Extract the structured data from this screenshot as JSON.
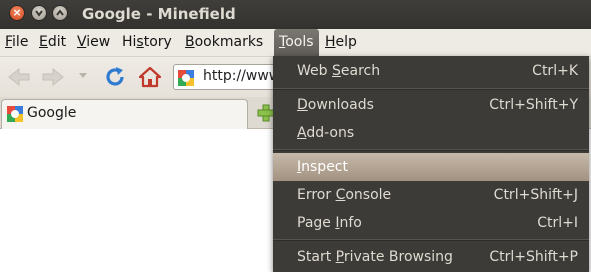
{
  "window": {
    "title": "Google - Minefield"
  },
  "menubar": {
    "items": [
      {
        "pre": "",
        "key": "F",
        "post": "ile"
      },
      {
        "pre": "",
        "key": "E",
        "post": "dit"
      },
      {
        "pre": "",
        "key": "V",
        "post": "iew"
      },
      {
        "pre": "Hi",
        "key": "s",
        "post": "tory"
      },
      {
        "pre": "",
        "key": "B",
        "post": "ookmarks"
      },
      {
        "pre": "",
        "key": "T",
        "post": "ools"
      },
      {
        "pre": "",
        "key": "H",
        "post": "elp"
      }
    ]
  },
  "navbar": {
    "url": "http://www."
  },
  "tabs": [
    {
      "label": "Google"
    }
  ],
  "tools_menu": {
    "items": [
      {
        "pre": "Web ",
        "key": "S",
        "post": "earch",
        "shortcut": "Ctrl+K"
      },
      {
        "pre": "",
        "key": "D",
        "post": "ownloads",
        "shortcut": "Ctrl+Shift+Y"
      },
      {
        "pre": "",
        "key": "A",
        "post": "dd-ons",
        "shortcut": ""
      },
      {
        "pre": "",
        "key": "I",
        "post": "nspect",
        "shortcut": ""
      },
      {
        "pre": "Error ",
        "key": "C",
        "post": "onsole",
        "shortcut": "Ctrl+Shift+J"
      },
      {
        "pre": "Page ",
        "key": "I",
        "post": "nfo",
        "shortcut": "Ctrl+I"
      },
      {
        "pre": "Start ",
        "key": "P",
        "post": "rivate Browsing",
        "shortcut": "Ctrl+Shift+P"
      }
    ],
    "highlighted": "Inspect"
  },
  "colors": {
    "titlebar": "#3c3b37",
    "menu_bg": "#3c3b37",
    "menu_highlight": "#b5a596",
    "menubar_bg": "#eeeae4"
  },
  "icons": [
    "close-icon",
    "minimize-icon",
    "maximize-icon",
    "back-icon",
    "forward-icon",
    "history-dropdown-icon",
    "reload-icon",
    "home-icon",
    "google-favicon",
    "new-tab-icon"
  ]
}
